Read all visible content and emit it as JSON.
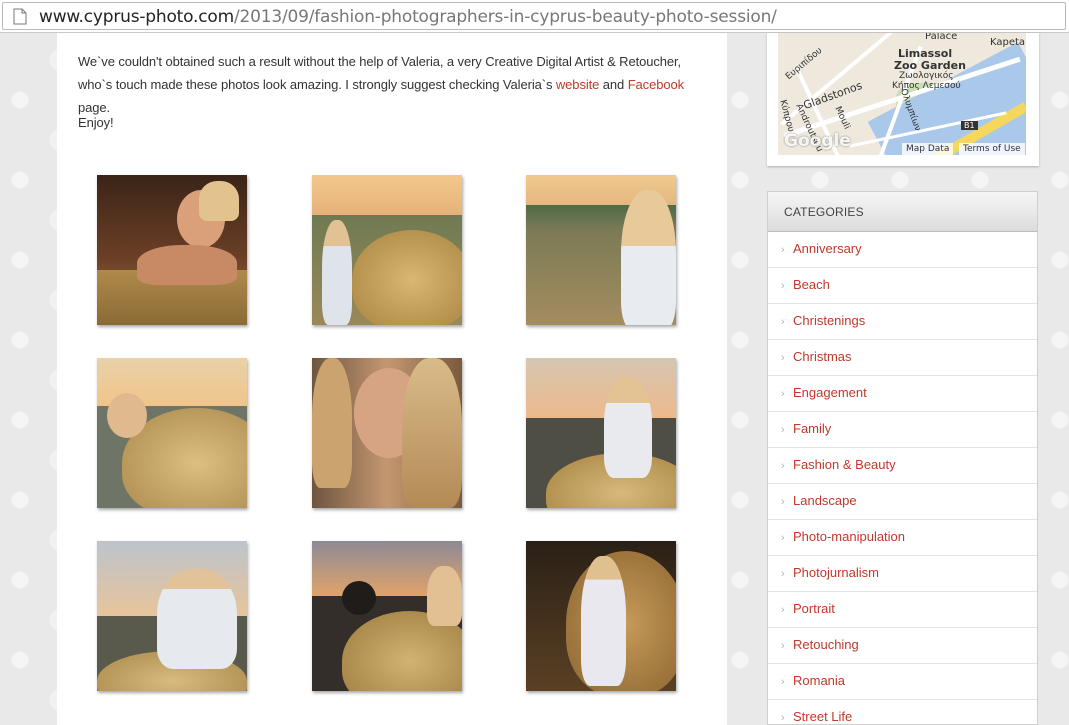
{
  "browser": {
    "url_host": "www.cyprus-photo.com",
    "url_path": "/2013/09/fashion-photographers-in-cyprus-beauty-photo-session/"
  },
  "article": {
    "paragraph1_prefix": "We`ve couldn't obtained such a result without the help of Valeria, a very Creative Digital Artist & Retoucher, who`s touch made these photos look amazing. I strongly suggest checking Valeria`s",
    "website_link": "website",
    "and_text": "and",
    "facebook_link": "Facebook",
    "paragraph1_suffix": "page.",
    "paragraph2": "Enjoy!"
  },
  "map": {
    "labels": {
      "palace": "Palace",
      "kapeta": "Kapeta",
      "limassol": "Limassol",
      "zoo": "Zoo Garden",
      "greek_zoo": "Ζωολογικός",
      "greek_garden": "Κήπος Λεμεσού",
      "gladstonos": "Gladstonos",
      "evripidou": "Ευριπίδου",
      "androutsou": "Androutsou",
      "mouli": "Mouli",
      "olympion": "Ολυμπίων",
      "kiprou": "Κύπρου",
      "road_b1": "B1"
    },
    "map_data": "Map Data",
    "terms": "Terms of Use",
    "logo": "Google"
  },
  "sidebar": {
    "categories_title": "CATEGORIES",
    "categories": [
      "Anniversary",
      "Beach",
      "Christenings",
      "Christmas",
      "Engagement",
      "Family",
      "Fashion & Beauty",
      "Landscape",
      "Photo-manipulation",
      "Photojurnalism",
      "Portrait",
      "Retouching",
      "Romania",
      "Street Life"
    ]
  }
}
